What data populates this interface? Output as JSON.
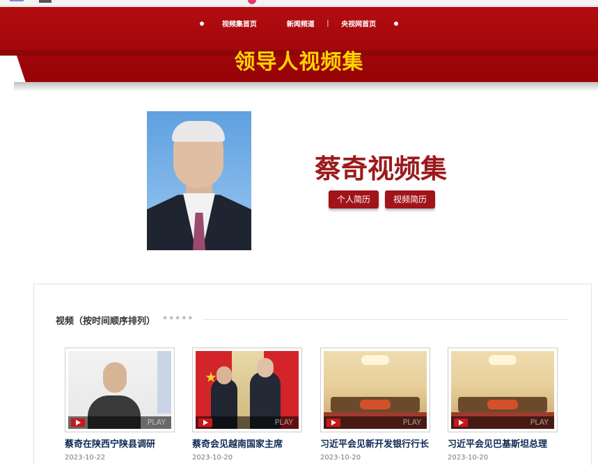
{
  "header": {
    "nav": [
      "视频集首页",
      "新闻频道",
      "央视网首页"
    ],
    "separator": "|",
    "banner_title": "领导人视频集"
  },
  "profile": {
    "name_title": "蔡奇视频集",
    "buttons": [
      "个人简历",
      "视频简历"
    ]
  },
  "videos_section": {
    "title": "视频（按时间顺序排列）",
    "stars": "★★★★★",
    "items": [
      {
        "caption": "蔡奇在陕西宁陕县调研",
        "date": "2023-10-22",
        "play": "PLAY"
      },
      {
        "caption": "蔡奇会见越南国家主席",
        "date": "2023-10-20",
        "play": "PLAY"
      },
      {
        "caption": "习近平会见新开发银行行长",
        "date": "2023-10-20",
        "play": "PLAY"
      },
      {
        "caption": "习近平会见巴基斯坦总理",
        "date": "2023-10-20",
        "play": "PLAY"
      }
    ]
  },
  "colors": {
    "banner_red": "#b30d10",
    "title_yellow": "#ffd400",
    "name_red": "#9b1a1d",
    "caption_navy": "#0e2a54"
  }
}
